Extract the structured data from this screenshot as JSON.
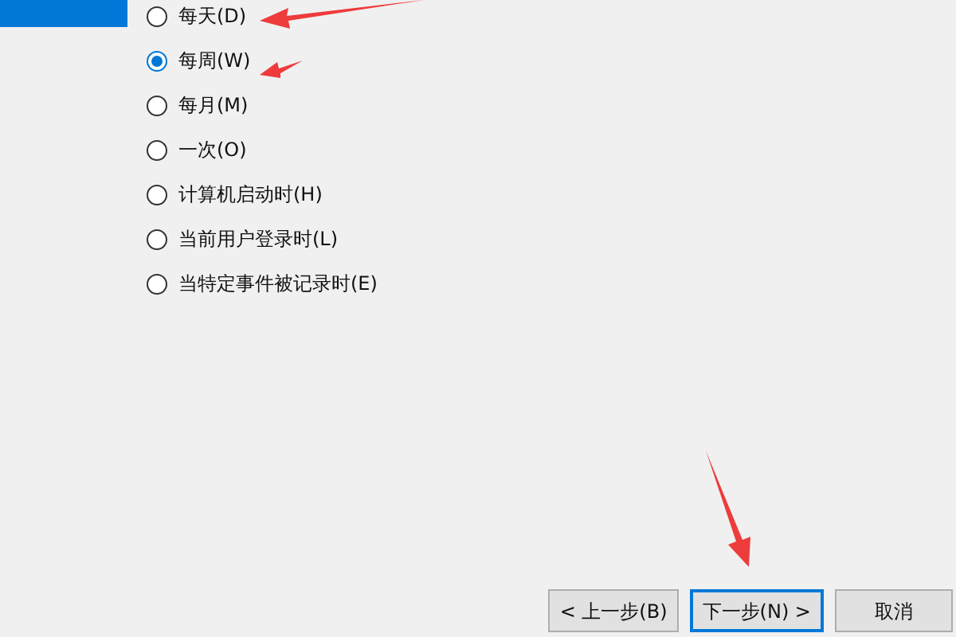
{
  "options": [
    {
      "label": "每天(D)",
      "selected": false
    },
    {
      "label": "每周(W)",
      "selected": true
    },
    {
      "label": "每月(M)",
      "selected": false
    },
    {
      "label": "一次(O)",
      "selected": false
    },
    {
      "label": "计算机启动时(H)",
      "selected": false
    },
    {
      "label": "当前用户登录时(L)",
      "selected": false
    },
    {
      "label": "当特定事件被记录时(E)",
      "selected": false
    }
  ],
  "buttons": [
    {
      "label": "< 上一步(B)",
      "default": false
    },
    {
      "label": "下一步(N) >",
      "default": true
    },
    {
      "label": "取消",
      "default": false
    }
  ]
}
